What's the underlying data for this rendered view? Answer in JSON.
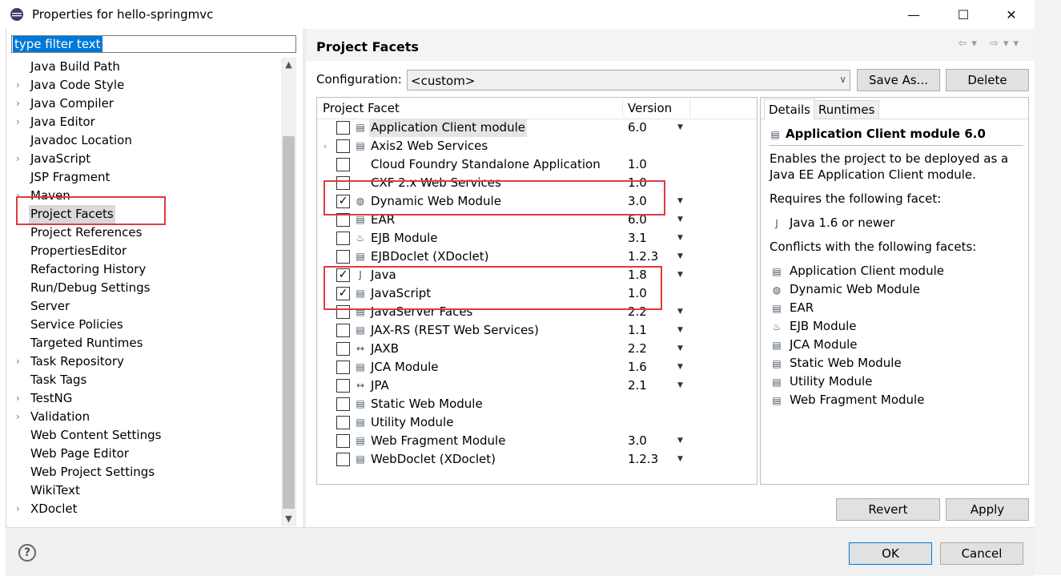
{
  "window": {
    "title": "Properties for hello-springmvc",
    "minimize": "—",
    "maximize": "☐",
    "close": "✕"
  },
  "filter": {
    "text": "type filter text"
  },
  "nav": [
    {
      "label": "Java Build Path",
      "expandable": false
    },
    {
      "label": "Java Code Style",
      "expandable": true
    },
    {
      "label": "Java Compiler",
      "expandable": true
    },
    {
      "label": "Java Editor",
      "expandable": true
    },
    {
      "label": "Javadoc Location",
      "expandable": false
    },
    {
      "label": "JavaScript",
      "expandable": true
    },
    {
      "label": "JSP Fragment",
      "expandable": false
    },
    {
      "label": "Maven",
      "expandable": true
    },
    {
      "label": "Project Facets",
      "expandable": false,
      "selected": true
    },
    {
      "label": "Project References",
      "expandable": false
    },
    {
      "label": "PropertiesEditor",
      "expandable": false
    },
    {
      "label": "Refactoring History",
      "expandable": false
    },
    {
      "label": "Run/Debug Settings",
      "expandable": false
    },
    {
      "label": "Server",
      "expandable": false
    },
    {
      "label": "Service Policies",
      "expandable": false
    },
    {
      "label": "Targeted Runtimes",
      "expandable": false
    },
    {
      "label": "Task Repository",
      "expandable": true
    },
    {
      "label": "Task Tags",
      "expandable": false
    },
    {
      "label": "TestNG",
      "expandable": true
    },
    {
      "label": "Validation",
      "expandable": true
    },
    {
      "label": "Web Content Settings",
      "expandable": false
    },
    {
      "label": "Web Page Editor",
      "expandable": false
    },
    {
      "label": "Web Project Settings",
      "expandable": false
    },
    {
      "label": "WikiText",
      "expandable": false
    },
    {
      "label": "XDoclet",
      "expandable": true
    }
  ],
  "page": {
    "title": "Project Facets"
  },
  "configuration": {
    "label": "Configuration:",
    "value": "<custom>",
    "save_as": "Save As...",
    "delete": "Delete"
  },
  "facet_table": {
    "col_facet": "Project Facet",
    "col_version": "Version",
    "rows": [
      {
        "name": "Application Client module",
        "version": "6.0",
        "checked": false,
        "dropdown": true,
        "highlight": true,
        "icon": "doc-icon"
      },
      {
        "name": "Axis2 Web Services",
        "version": "",
        "checked": false,
        "dropdown": false,
        "expandable": true,
        "icon": "doc-icon"
      },
      {
        "name": "Cloud Foundry Standalone Application",
        "version": "1.0",
        "checked": false,
        "dropdown": false,
        "icon": ""
      },
      {
        "name": "CXF 2.x Web Services",
        "version": "1.0",
        "checked": false,
        "dropdown": false,
        "icon": ""
      },
      {
        "name": "Dynamic Web Module",
        "version": "3.0",
        "checked": true,
        "dropdown": true,
        "icon": "globe-icon"
      },
      {
        "name": "EAR",
        "version": "6.0",
        "checked": false,
        "dropdown": true,
        "icon": "doc-icon"
      },
      {
        "name": "EJB Module",
        "version": "3.1",
        "checked": false,
        "dropdown": true,
        "icon": "bean-icon"
      },
      {
        "name": "EJBDoclet (XDoclet)",
        "version": "1.2.3",
        "checked": false,
        "dropdown": true,
        "icon": "doc-icon"
      },
      {
        "name": "Java",
        "version": "1.8",
        "checked": true,
        "dropdown": true,
        "icon": "java-icon"
      },
      {
        "name": "JavaScript",
        "version": "1.0",
        "checked": true,
        "dropdown": false,
        "icon": "doc-icon"
      },
      {
        "name": "JavaServer Faces",
        "version": "2.2",
        "checked": false,
        "dropdown": true,
        "icon": "doc-icon"
      },
      {
        "name": "JAX-RS (REST Web Services)",
        "version": "1.1",
        "checked": false,
        "dropdown": true,
        "icon": "doc-icon"
      },
      {
        "name": "JAXB",
        "version": "2.2",
        "checked": false,
        "dropdown": true,
        "icon": "arrows-icon"
      },
      {
        "name": "JCA Module",
        "version": "1.6",
        "checked": false,
        "dropdown": true,
        "icon": "doc-icon"
      },
      {
        "name": "JPA",
        "version": "2.1",
        "checked": false,
        "dropdown": true,
        "icon": "arrows-icon"
      },
      {
        "name": "Static Web Module",
        "version": "",
        "checked": false,
        "dropdown": false,
        "icon": "doc-icon"
      },
      {
        "name": "Utility Module",
        "version": "",
        "checked": false,
        "dropdown": false,
        "icon": "doc-icon"
      },
      {
        "name": "Web Fragment Module",
        "version": "3.0",
        "checked": false,
        "dropdown": true,
        "icon": "doc-icon"
      },
      {
        "name": "WebDoclet (XDoclet)",
        "version": "1.2.3",
        "checked": false,
        "dropdown": true,
        "icon": "doc-icon"
      }
    ]
  },
  "details": {
    "tab_details": "Details",
    "tab_runtimes": "Runtimes",
    "title": "Application Client module 6.0",
    "description_1": "Enables the project to be deployed as a",
    "description_2": "Java EE Application Client module.",
    "requires_label": "Requires the following facet:",
    "requires": [
      {
        "label": "Java 1.6 or newer",
        "icon": "java-icon"
      }
    ],
    "conflicts_label": "Conflicts with the following facets:",
    "conflicts": [
      {
        "label": "Application Client module",
        "icon": "doc-icon"
      },
      {
        "label": "Dynamic Web Module",
        "icon": "globe-icon"
      },
      {
        "label": "EAR",
        "icon": "doc-icon"
      },
      {
        "label": "EJB Module",
        "icon": "bean-icon"
      },
      {
        "label": "JCA Module",
        "icon": "doc-icon"
      },
      {
        "label": "Static Web Module",
        "icon": "doc-icon"
      },
      {
        "label": "Utility Module",
        "icon": "doc-icon"
      },
      {
        "label": "Web Fragment Module",
        "icon": "doc-icon"
      }
    ]
  },
  "buttons": {
    "revert": "Revert",
    "apply": "Apply",
    "ok": "OK",
    "cancel": "Cancel",
    "help": "?"
  },
  "colors": {
    "highlight_box": "#e03a3e",
    "selection": "#0078d7"
  }
}
